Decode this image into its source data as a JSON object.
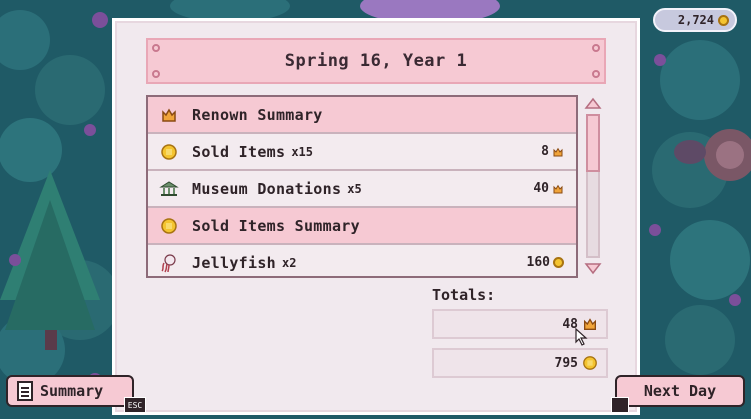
{
  "date": "Spring 16, Year 1",
  "gold_total": "2,724",
  "rows": [
    {
      "type": "header",
      "icon": "renown-icon",
      "label": "Renown Summary"
    },
    {
      "type": "item",
      "icon": "coin-icon",
      "label": "Sold Items",
      "qty": "x15",
      "value": "8",
      "value_icon": "renown-icon"
    },
    {
      "type": "item",
      "icon": "museum-icon",
      "label": "Museum Donations",
      "qty": "x5",
      "value": "40",
      "value_icon": "renown-icon"
    },
    {
      "type": "header",
      "icon": "coin-icon",
      "label": "Sold Items Summary"
    },
    {
      "type": "item",
      "icon": "jellyfish-icon",
      "label": "Jellyfish",
      "qty": "x2",
      "value": "160",
      "value_icon": "coin-icon"
    }
  ],
  "totals": {
    "label": "Totals:",
    "renown": "48",
    "gold": "795"
  },
  "buttons": {
    "summary": "Summary",
    "summary_key": "ESC",
    "next_day": "Next Day"
  },
  "scroll_position": 0.0,
  "colors": {
    "accent_pink": "#f6c9d3",
    "panel": "#f1e9ee",
    "coin": "#f4c430",
    "renown": "#e08a1e"
  }
}
